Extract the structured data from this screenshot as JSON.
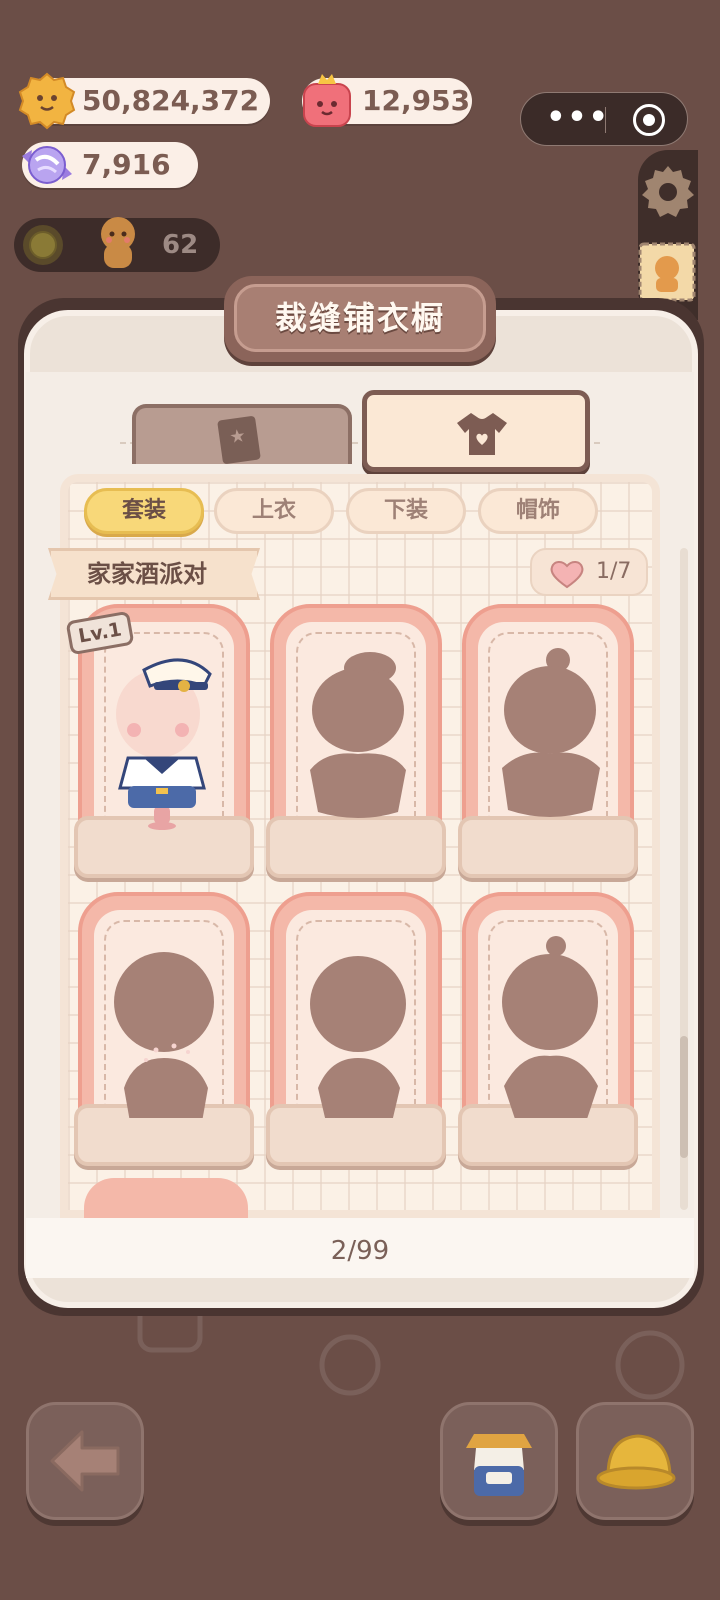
{
  "currencies": {
    "cookies": "50,824,372",
    "gems": "12,953",
    "candy": "7,916"
  },
  "level": {
    "count": "62"
  },
  "wardrobe": {
    "title": "裁缝铺衣橱",
    "categories": [
      {
        "label": "套装",
        "active": true
      },
      {
        "label": "上衣",
        "active": false
      },
      {
        "label": "下装",
        "active": false
      },
      {
        "label": "帽饰",
        "active": false
      }
    ],
    "set_name": "家家酒派对",
    "collected": "1/7",
    "first_card_level": "Lv.1",
    "page": "2/99"
  },
  "colors": {
    "background": "#6b4e47",
    "accent_yellow": "#f8d879",
    "card_pink": "#f4b8a9",
    "silhouette": "#a68176"
  },
  "icons": [
    "cookie-icon",
    "gem-icon",
    "candy-icon",
    "sun-icon",
    "gingerbread-icon",
    "gear-icon",
    "stamp-icon",
    "book-icon",
    "shirt-icon",
    "heart-icon",
    "back-arrow-icon",
    "outfit-icon",
    "hat-icon"
  ]
}
